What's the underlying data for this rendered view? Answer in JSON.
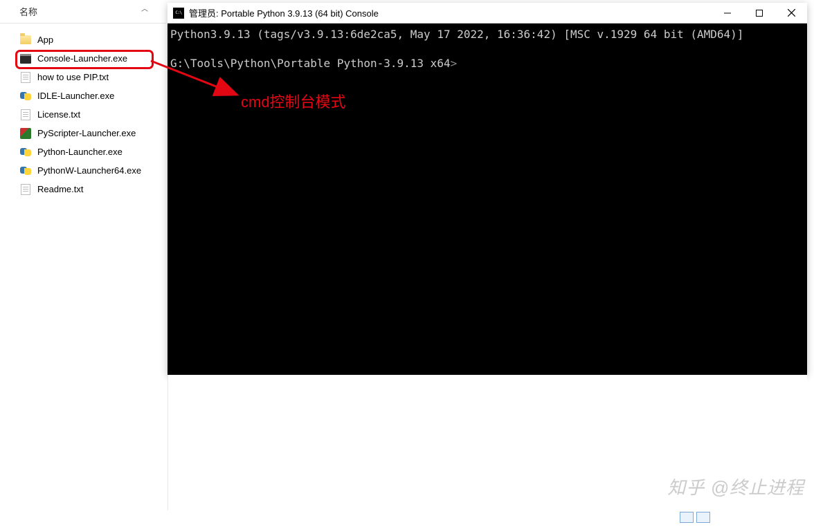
{
  "explorer": {
    "column_header": "名称",
    "files": [
      {
        "name": "App",
        "icon": "folder"
      },
      {
        "name": "Console-Launcher.exe",
        "icon": "exe",
        "highlighted": true
      },
      {
        "name": "how to use PIP.txt",
        "icon": "txt"
      },
      {
        "name": "IDLE-Launcher.exe",
        "icon": "py"
      },
      {
        "name": "License.txt",
        "icon": "txt"
      },
      {
        "name": "PyScripter-Launcher.exe",
        "icon": "pyscripter"
      },
      {
        "name": "Python-Launcher.exe",
        "icon": "py"
      },
      {
        "name": "PythonW-Launcher64.exe",
        "icon": "py"
      },
      {
        "name": "Readme.txt",
        "icon": "txt"
      }
    ]
  },
  "console": {
    "title": "管理员:  Portable Python 3.9.13 (64 bit) Console",
    "line1": "Python3.9.13 (tags/v3.9.13:6de2ca5, May 17 2022, 16:36:42) [MSC v.1929 64 bit (AMD64)]",
    "prompt_path": "G:\\Tools\\Python\\Portable Python-3.9.13 x64",
    "prompt_symbol": ">"
  },
  "annotation": {
    "text": "cmd控制台模式",
    "color": "#e30613"
  },
  "watermark": "知乎 @终止进程"
}
